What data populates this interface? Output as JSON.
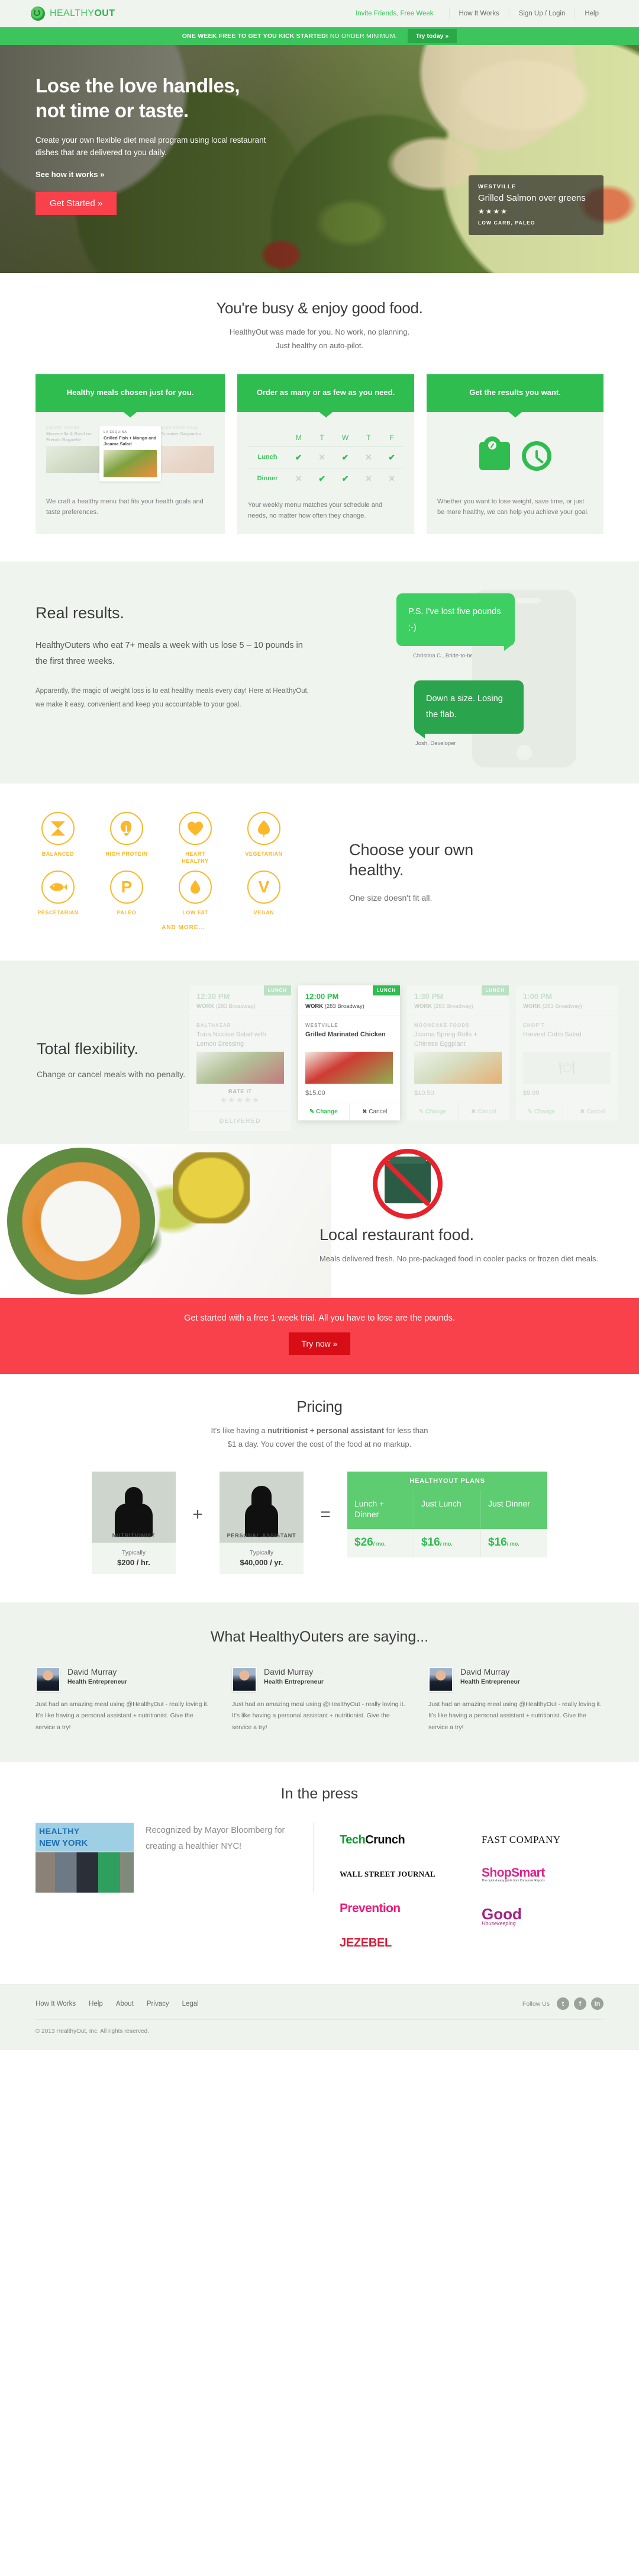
{
  "brand": {
    "name_light": "HEALTHY",
    "name_bold": "OUT",
    "accent_green": "#3ec45c",
    "accent_red": "#f8414a",
    "accent_orange": "#fcb72b"
  },
  "topnav": {
    "invite": "Invite Friends, Free Week",
    "links": [
      "How It Works",
      "Sign Up / Login",
      "Help"
    ]
  },
  "promo": {
    "bold": "ONE WEEK FREE TO GET YOU KICK STARTED!",
    "thin": " NO ORDER MINIMUM.",
    "button": "Try today »"
  },
  "hero": {
    "headline_line1": "Lose the love handles,",
    "headline_line2": "not time or taste.",
    "sub": "Create your own flexible diet meal program using local restaurant dishes that are delivered to you daily.",
    "link": "See how it works »",
    "cta": "Get Started »",
    "meal_badge": {
      "restaurant": "WESTVILLE",
      "dish": "Grilled Salmon over greens",
      "stars": "★★★★",
      "tags": "LOW CARB, PALEO"
    }
  },
  "busy": {
    "title": "You're busy & enjoy good food.",
    "lead_line1": "HealthyOut was made for you. No work, no planning.",
    "lead_line2": "Just healthy on auto-pilot.",
    "cards": [
      {
        "head": "Healthy meals chosen just for you.",
        "text": "We craft a healthy menu that fits your health goals and taste preferences.",
        "mini_menu": [
          {
            "restaurant": "LIBRARY TAVERN",
            "dish": "Mozzarella & Basil on French Baguette"
          },
          {
            "restaurant": "LA ESQUINA",
            "dish": "Grilled Fish + Mango and Jicama Salad"
          },
          {
            "restaurant": "BLUE WATER GRILL",
            "dish": "Summer Gazpacho"
          }
        ]
      },
      {
        "head": "Order as many or as few as you need.",
        "text": "Your weekly menu matches your schedule and needs, no matter how often they change.",
        "schedule": {
          "days": [
            "M",
            "T",
            "W",
            "T",
            "F"
          ],
          "rows": [
            {
              "label": "Lunch",
              "values": [
                true,
                false,
                true,
                false,
                true
              ]
            },
            {
              "label": "Dinner",
              "values": [
                false,
                true,
                true,
                false,
                false
              ]
            }
          ]
        }
      },
      {
        "head": "Get the results you want.",
        "text": "Whether you want to lose weight, save time, or just be more healthy, we can help you achieve your goal."
      }
    ]
  },
  "results": {
    "title": "Real results.",
    "big": "HealthyOuters who eat 7+ meals a week with us lose 5 – 10 pounds in the first three weeks.",
    "small": "Apparently, the magic of weight loss is to eat healthy meals every day! Here at HealthyOut, we make it easy, convenient and keep you accountable to your goal.",
    "bubbles": [
      {
        "text": "P.S. I've lost five pounds ;-)",
        "author": "Christina C., Bride-to-be"
      },
      {
        "text": "Down a size. Losing the flab.",
        "author": "Josh, Developer"
      }
    ]
  },
  "choose": {
    "title_line1": "Choose your own",
    "title_line2": "healthy.",
    "sub": "One size doesn't fit all.",
    "and_more": "AND MORE...",
    "diets": [
      {
        "label": "BALANCED",
        "icon": "hourglass-icon",
        "glyph": ""
      },
      {
        "label": "HIGH PROTEIN",
        "icon": "drumstick-icon",
        "glyph": "🍗"
      },
      {
        "label": "HEART HEALTHY",
        "icon": "heart-icon",
        "glyph": "♥"
      },
      {
        "label": "VEGETARIAN",
        "icon": "leaf-icon",
        "glyph": "🍃"
      },
      {
        "label": "PESCETARIAN",
        "icon": "fish-icon",
        "glyph": "🐟"
      },
      {
        "label": "PALEO",
        "icon": "letter-p-icon",
        "glyph": "P"
      },
      {
        "label": "LOW FAT",
        "icon": "droplet-icon",
        "glyph": "💧"
      },
      {
        "label": "VEGAN",
        "icon": "letter-v-icon",
        "glyph": "V"
      }
    ]
  },
  "flexibility": {
    "title": "Total flexibility.",
    "sub": "Change or cancel meals with no penalty.",
    "meals": [
      {
        "time": "12:30 PM",
        "location_bold": "WORK",
        "location_rest": " (283 Broadway)",
        "tag": "LUNCH",
        "restaurant": "BALTHAZAR",
        "dish": "Tuna Nicoise Salad with Lemon Dressing",
        "price": "",
        "rate_label": "RATE IT",
        "stars": "★★★★★",
        "status": "DELIVERED",
        "state": "dim"
      },
      {
        "time": "12:00 PM",
        "location_bold": "WORK",
        "location_rest": " (283 Broadway)",
        "tag": "LUNCH",
        "restaurant": "WESTVILLE",
        "dish": "Grilled Marinated Chicken",
        "price": "$15.00",
        "change": "Change",
        "cancel": "Cancel",
        "state": "active"
      },
      {
        "time": "1:30 PM",
        "location_bold": "WORK",
        "location_rest": " (283 Broadway)",
        "tag": "LUNCH",
        "restaurant": "MOONCAKE FOODS",
        "dish": "Jicama Spring Rolls + Chinese Eggplant",
        "price": "$10.50",
        "change": "Change",
        "cancel": "Cancel",
        "state": "dim"
      },
      {
        "time": "1:00 PM",
        "location_bold": "WORK",
        "location_rest": " (283 Broadway)",
        "tag": "",
        "restaurant": "CHOP'T",
        "dish": "Harvest Cobb Salad",
        "price": "$9.99",
        "change": "Change",
        "cancel": "Cancel",
        "state": "dim"
      }
    ]
  },
  "local": {
    "title": "Local restaurant food.",
    "sub": "Meals delivered fresh. No pre-packaged food in cooler packs or frozen diet meals."
  },
  "cta_banner": {
    "text": "Get started with a free 1 week trial. All you have to lose are the pounds.",
    "button": "Try now »"
  },
  "pricing": {
    "title": "Pricing",
    "lead_before": "It's like having a ",
    "lead_bold": "nutritionist + personal assistant",
    "lead_after": " for less than",
    "lead_line2": "$1 a day. You cover the cost of the food at no markup.",
    "comparison": [
      {
        "label": "NUTRITIONIST",
        "typically": "Typically",
        "cost": "$200 / hr."
      },
      {
        "label": "PERSONAL ASSISTANT",
        "typically": "Typically",
        "cost": "$40,000 / yr."
      }
    ],
    "op_plus": "+",
    "op_equals": "=",
    "plans_header": "HEALTHYOUT PLANS",
    "plans": [
      {
        "name": "Lunch + Dinner",
        "amount": "$26",
        "per": "/ mo."
      },
      {
        "name": "Just Lunch",
        "amount": "$16",
        "per": "/ mo."
      },
      {
        "name": "Just Dinner",
        "amount": "$16",
        "per": "/ mo."
      }
    ]
  },
  "testimonials": {
    "title": "What HealthyOuters are saying...",
    "items": [
      {
        "name": "David Murray",
        "role": "Health Entrepreneur",
        "text": "Just had an amazing meal using @HealthyOut - really loving it. It's like having a personal assistant + nutritionist. Give the service a try!"
      },
      {
        "name": "David Murray",
        "role": "Health Entrepreneur",
        "text": "Just had an amazing meal using @HealthyOut - really loving it. It's like having a personal assistant + nutritionist. Give the service a try!"
      },
      {
        "name": "David Murray",
        "role": "Health Entrepreneur",
        "text": "Just had an amazing meal using @HealthyOut - really loving it. It's like having a personal assistant + nutritionist. Give the service a try!"
      }
    ]
  },
  "press": {
    "title": "In the press",
    "photo_banner_1": "HEALTHY",
    "photo_banner_2": "NEW YORK",
    "caption": "Recognized by Mayor Bloomberg for creating a healthier NYC!",
    "logos_col1": [
      "TechCrunch",
      "WALL STREET JOURNAL",
      "Prevention",
      "JEZEBEL"
    ],
    "logos_col2": [
      "FAST COMPANY",
      "ShopSmart",
      "Good Housekeeping"
    ],
    "shopsmart_tagline": "The quick & easy guide from Consumer Reports"
  },
  "footer": {
    "links": [
      "How It Works",
      "Help",
      "About",
      "Privacy",
      "Legal"
    ],
    "follow_label": "Follow Us",
    "social": [
      "twitter-icon",
      "facebook-icon",
      "linkedin-icon"
    ],
    "social_glyphs": [
      "t",
      "f",
      "in"
    ],
    "copyright": "© 2013 HealthyOut, Inc. All rights reserved."
  }
}
